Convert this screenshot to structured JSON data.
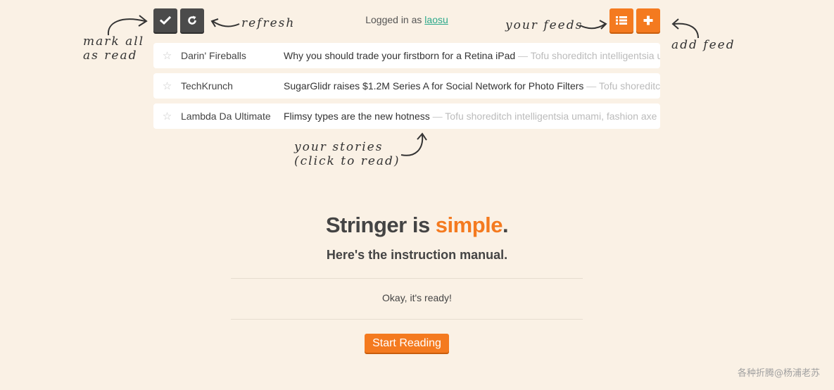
{
  "header": {
    "logged_in_prefix": "Logged in as ",
    "username": "laosu"
  },
  "toolbar": {
    "mark_all_icon": "check-icon",
    "refresh_icon": "refresh-icon",
    "feeds_icon": "list-icon",
    "add_feed_icon": "plus-icon"
  },
  "annotations": {
    "mark_all_line1": "mark all",
    "mark_all_line2": "as read",
    "refresh": "refresh",
    "your_feeds": "your feeds",
    "add_feed": "add feed",
    "stories_line1": "your stories",
    "stories_line2": "(click to read)"
  },
  "stories": [
    {
      "feed": "Darin' Fireballs",
      "title": "Why you should trade your firstborn for a Retina iPad",
      "excerpt": "Tofu shoreditch intelligentsia umami, fashion axe"
    },
    {
      "feed": "TechKrunch",
      "title": "SugarGlidr raises $1.2M Series A for Social Network for Photo Filters",
      "excerpt": "Tofu shoreditch intelligentsia umami, fashion axe"
    },
    {
      "feed": "Lambda Da Ultimate",
      "title": "Flimsy types are the new hotness",
      "excerpt": "Tofu shoreditch intelligentsia umami, fashion axe"
    }
  ],
  "story_separator": " — ",
  "intro": {
    "headline_start": "Stringer is ",
    "headline_accent": "simple",
    "headline_end": ".",
    "subhead": "Here's the instruction manual.",
    "ready": "Okay, it's ready!",
    "start_button": "Start Reading"
  },
  "watermark": "各种折腾@杨浦老苏",
  "colors": {
    "background": "#faf1e5",
    "accent": "#f47a1f",
    "dark_button": "#4b4b4b",
    "link": "#2aa88a"
  }
}
